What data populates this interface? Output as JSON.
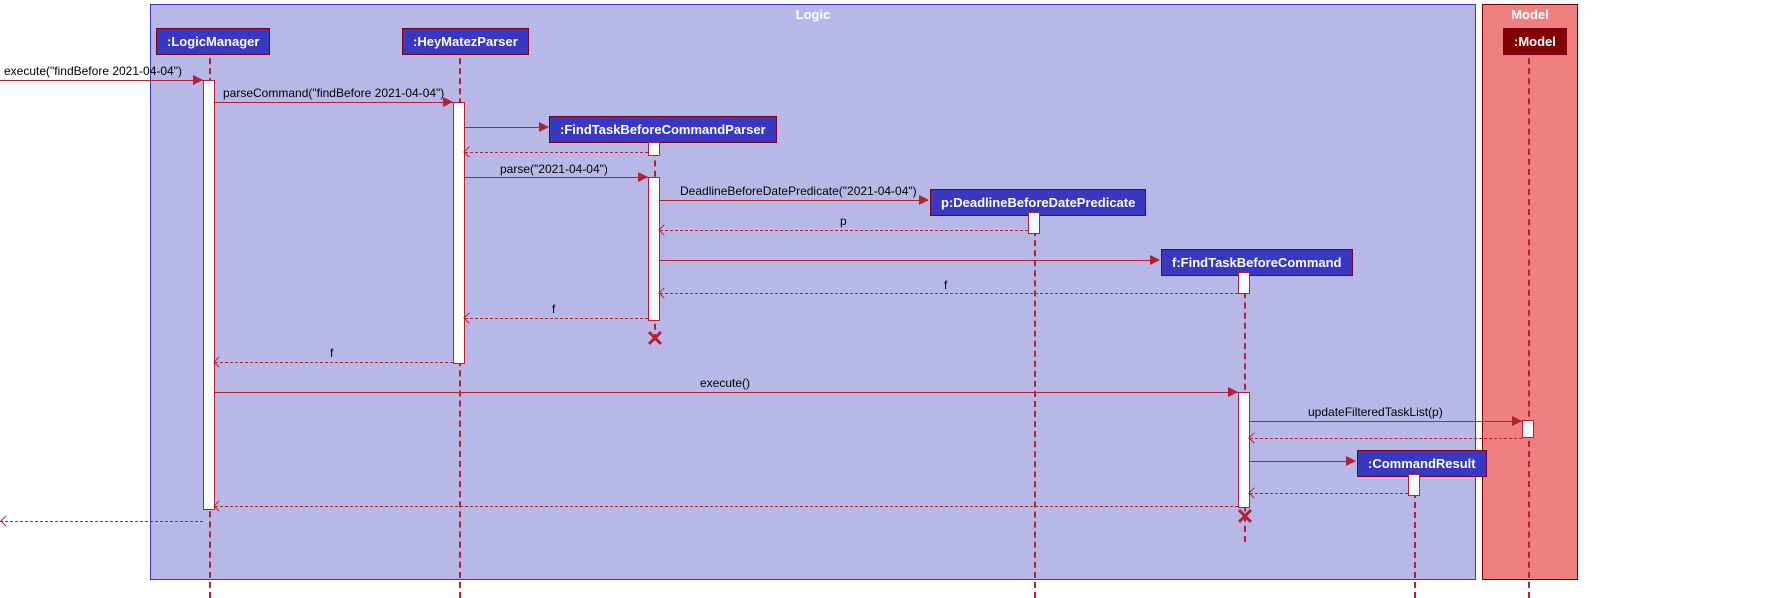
{
  "frames": {
    "logic": {
      "label": "Logic"
    },
    "model": {
      "label": "Model"
    }
  },
  "participants": {
    "logicManager": ":LogicManager",
    "heyMatezParser": ":HeyMatezParser",
    "findTaskBeforeCommandParser": ":FindTaskBeforeCommandParser",
    "deadlinePredicate": "p:DeadlineBeforeDatePredicate",
    "findTaskBeforeCommand": "f:FindTaskBeforeCommand",
    "commandResult": ":CommandResult",
    "model": ":Model"
  },
  "messages": {
    "execute1": "execute(\"findBefore 2021-04-04\")",
    "parseCommand": "parseCommand(\"findBefore 2021-04-04\")",
    "parse": "parse(\"2021-04-04\")",
    "deadlinePred": "DeadlineBeforeDatePredicate(\"2021-04-04\")",
    "return_p": "p",
    "return_f": "f",
    "execute2": "execute()",
    "updateFiltered": "updateFilteredTaskList(p)"
  },
  "colors": {
    "logicFrameBg": "#b8b8e8",
    "logicFrameBorder": "#3838c2",
    "modelFrameBg": "#f08080",
    "modelFrameBorder": "#800000",
    "participantBg": "#3838c2",
    "modelParticipantBg": "#800000",
    "arrow": "#B22234"
  }
}
